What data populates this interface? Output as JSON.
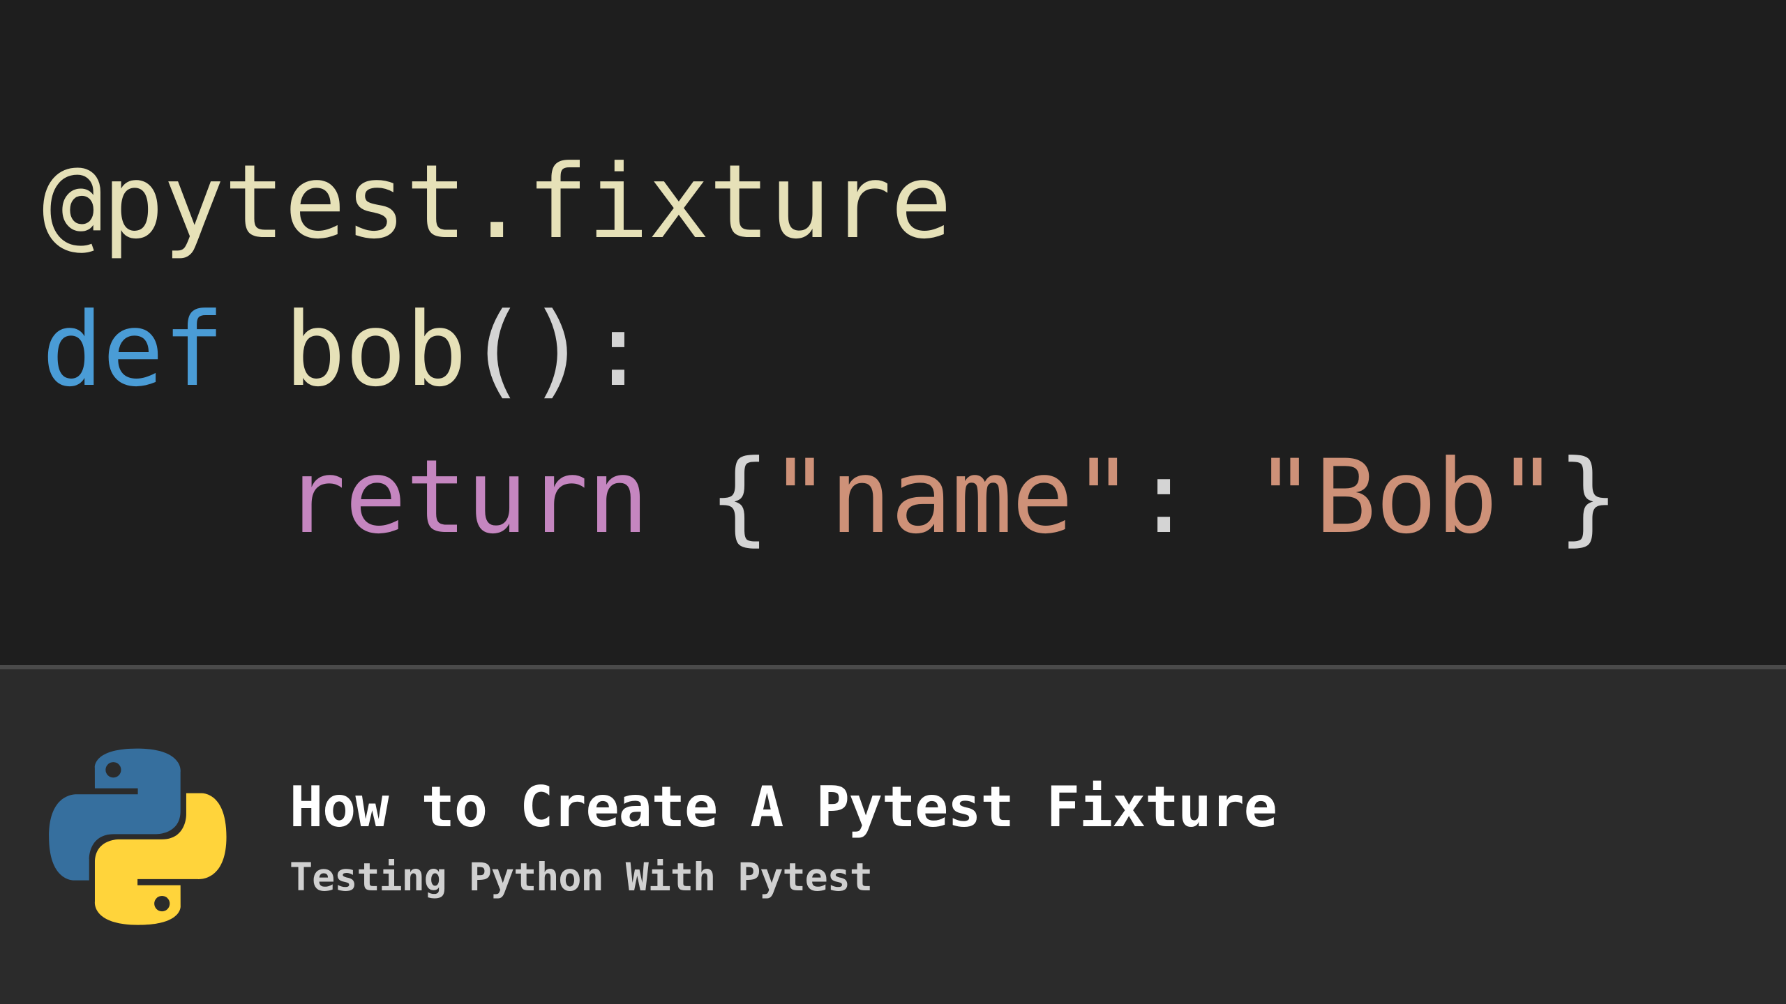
{
  "code": {
    "line1": {
      "decorator": "@pytest.fixture"
    },
    "line2": {
      "def": "def",
      "space1": " ",
      "fname": "bob",
      "parens": "():"
    },
    "line3": {
      "indent": "    ",
      "return": "return",
      "space1": " ",
      "brace_open": "{",
      "string1": "\"name\"",
      "colon": ":",
      "space2": " ",
      "string2": "\"Bob\"",
      "brace_close": "}"
    }
  },
  "footer": {
    "title": "How to Create A Pytest Fixture",
    "subtitle": "Testing Python With Pytest"
  },
  "colors": {
    "code_bg": "#1e1e1e",
    "footer_bg": "#2b2b2b",
    "decorator": "#e6e1b8",
    "def": "#4a9cd6",
    "return": "#c586c0",
    "string": "#ce9178",
    "punct": "#d4d4d4",
    "python_blue": "#366f9e",
    "python_yellow": "#ffd43b"
  }
}
